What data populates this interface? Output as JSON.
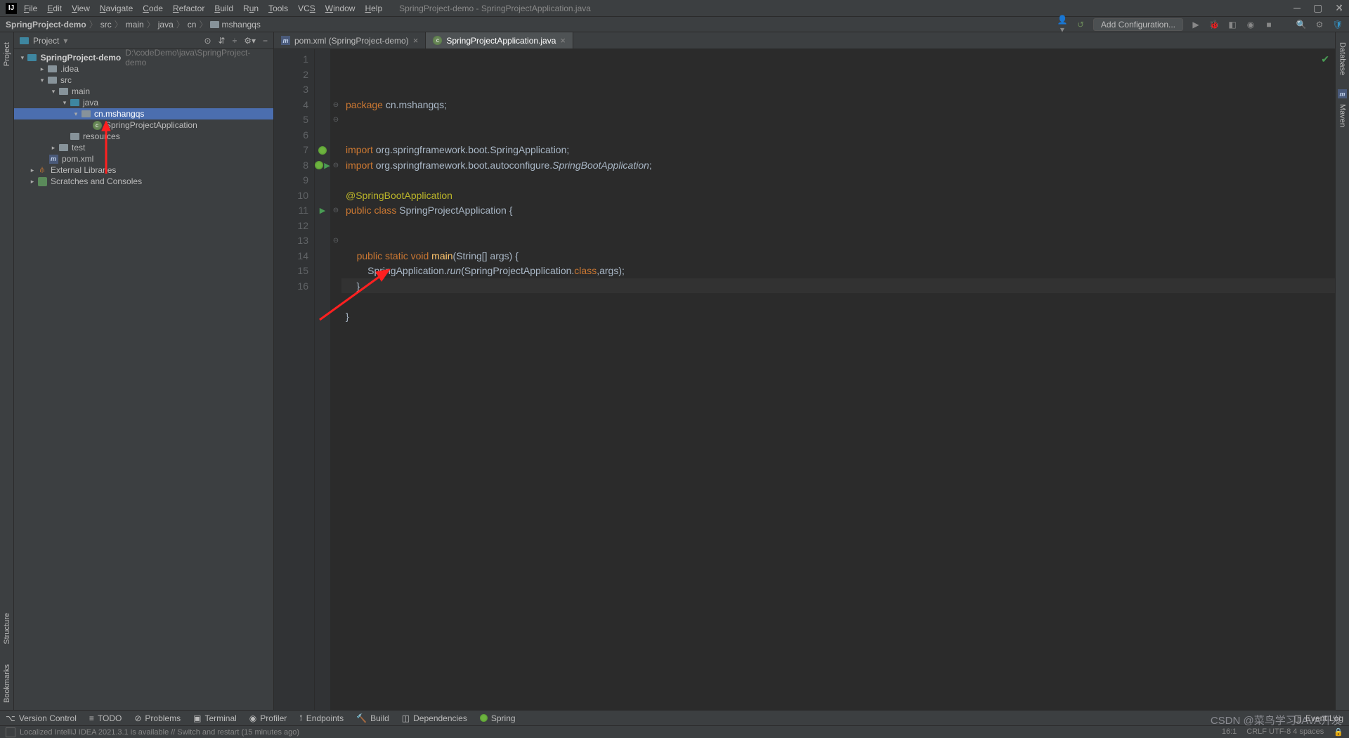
{
  "window": {
    "title": "SpringProject-demo - SpringProjectApplication.java",
    "logo": "IJ"
  },
  "menu": [
    "File",
    "Edit",
    "View",
    "Navigate",
    "Code",
    "Refactor",
    "Build",
    "Run",
    "Tools",
    "VCS",
    "Window",
    "Help"
  ],
  "breadcrumbs": [
    "SpringProject-demo",
    "src",
    "main",
    "java",
    "cn",
    "mshangqs"
  ],
  "toolbar_right": {
    "add_conf": "Add Configuration..."
  },
  "project_pane": {
    "title": "Project"
  },
  "tree": {
    "root": "SpringProject-demo",
    "root_path": "D:\\codeDemo\\java\\SpringProject-demo",
    "idea": ".idea",
    "src": "src",
    "main": "main",
    "java": "java",
    "pkg": "cn.mshangqs",
    "app": "SpringProjectApplication",
    "resources": "resources",
    "test": "test",
    "pom": "pom.xml",
    "extlib": "External Libraries",
    "scratch": "Scratches and Consoles"
  },
  "tabs": [
    {
      "label": "pom.xml (SpringProject-demo)",
      "active": false,
      "icon": "m"
    },
    {
      "label": "SpringProjectApplication.java",
      "active": true,
      "icon": "java"
    }
  ],
  "code_lines": [
    1,
    2,
    3,
    4,
    5,
    6,
    7,
    8,
    9,
    10,
    11,
    12,
    13,
    14,
    15,
    16
  ],
  "code": {
    "l1": "package cn.mshangqs;",
    "l4a": "import",
    "l4b": " org.springframework.boot.SpringApplication;",
    "l5a": "import",
    "l5b": " org.springframework.boot.autoconfigure.",
    "l5c": "SpringBootApplication",
    "l5d": ";",
    "l7": "@SpringBootApplication",
    "l8a": "public class ",
    "l8b": "SpringProjectApplication ",
    "l8c": "{",
    "l11a": "    public static void ",
    "l11b": "main",
    "l11c": "(String[] args) {",
    "l12a": "        SpringApplication.",
    "l12b": "run",
    "l12c": "(SpringProjectApplication.",
    "l12d": "class",
    "l12e": ",args);",
    "l13": "    }",
    "l15": "}"
  },
  "left_tools": [
    "Project",
    "Structure",
    "Bookmarks"
  ],
  "right_tools": [
    "Database",
    "Maven"
  ],
  "bottom_tools": [
    "Version Control",
    "TODO",
    "Problems",
    "Terminal",
    "Profiler",
    "Endpoints",
    "Build",
    "Dependencies",
    "Spring"
  ],
  "bottom_right": "Event Log",
  "status": {
    "msg": "Localized IntelliJ IDEA 2021.3.1 is available // Switch and restart (15 minutes ago)",
    "pos": "16:1",
    "enc": "CRLF   UTF-8   4 spaces"
  },
  "watermark": "CSDN @菜鸟学习JAVA开发"
}
